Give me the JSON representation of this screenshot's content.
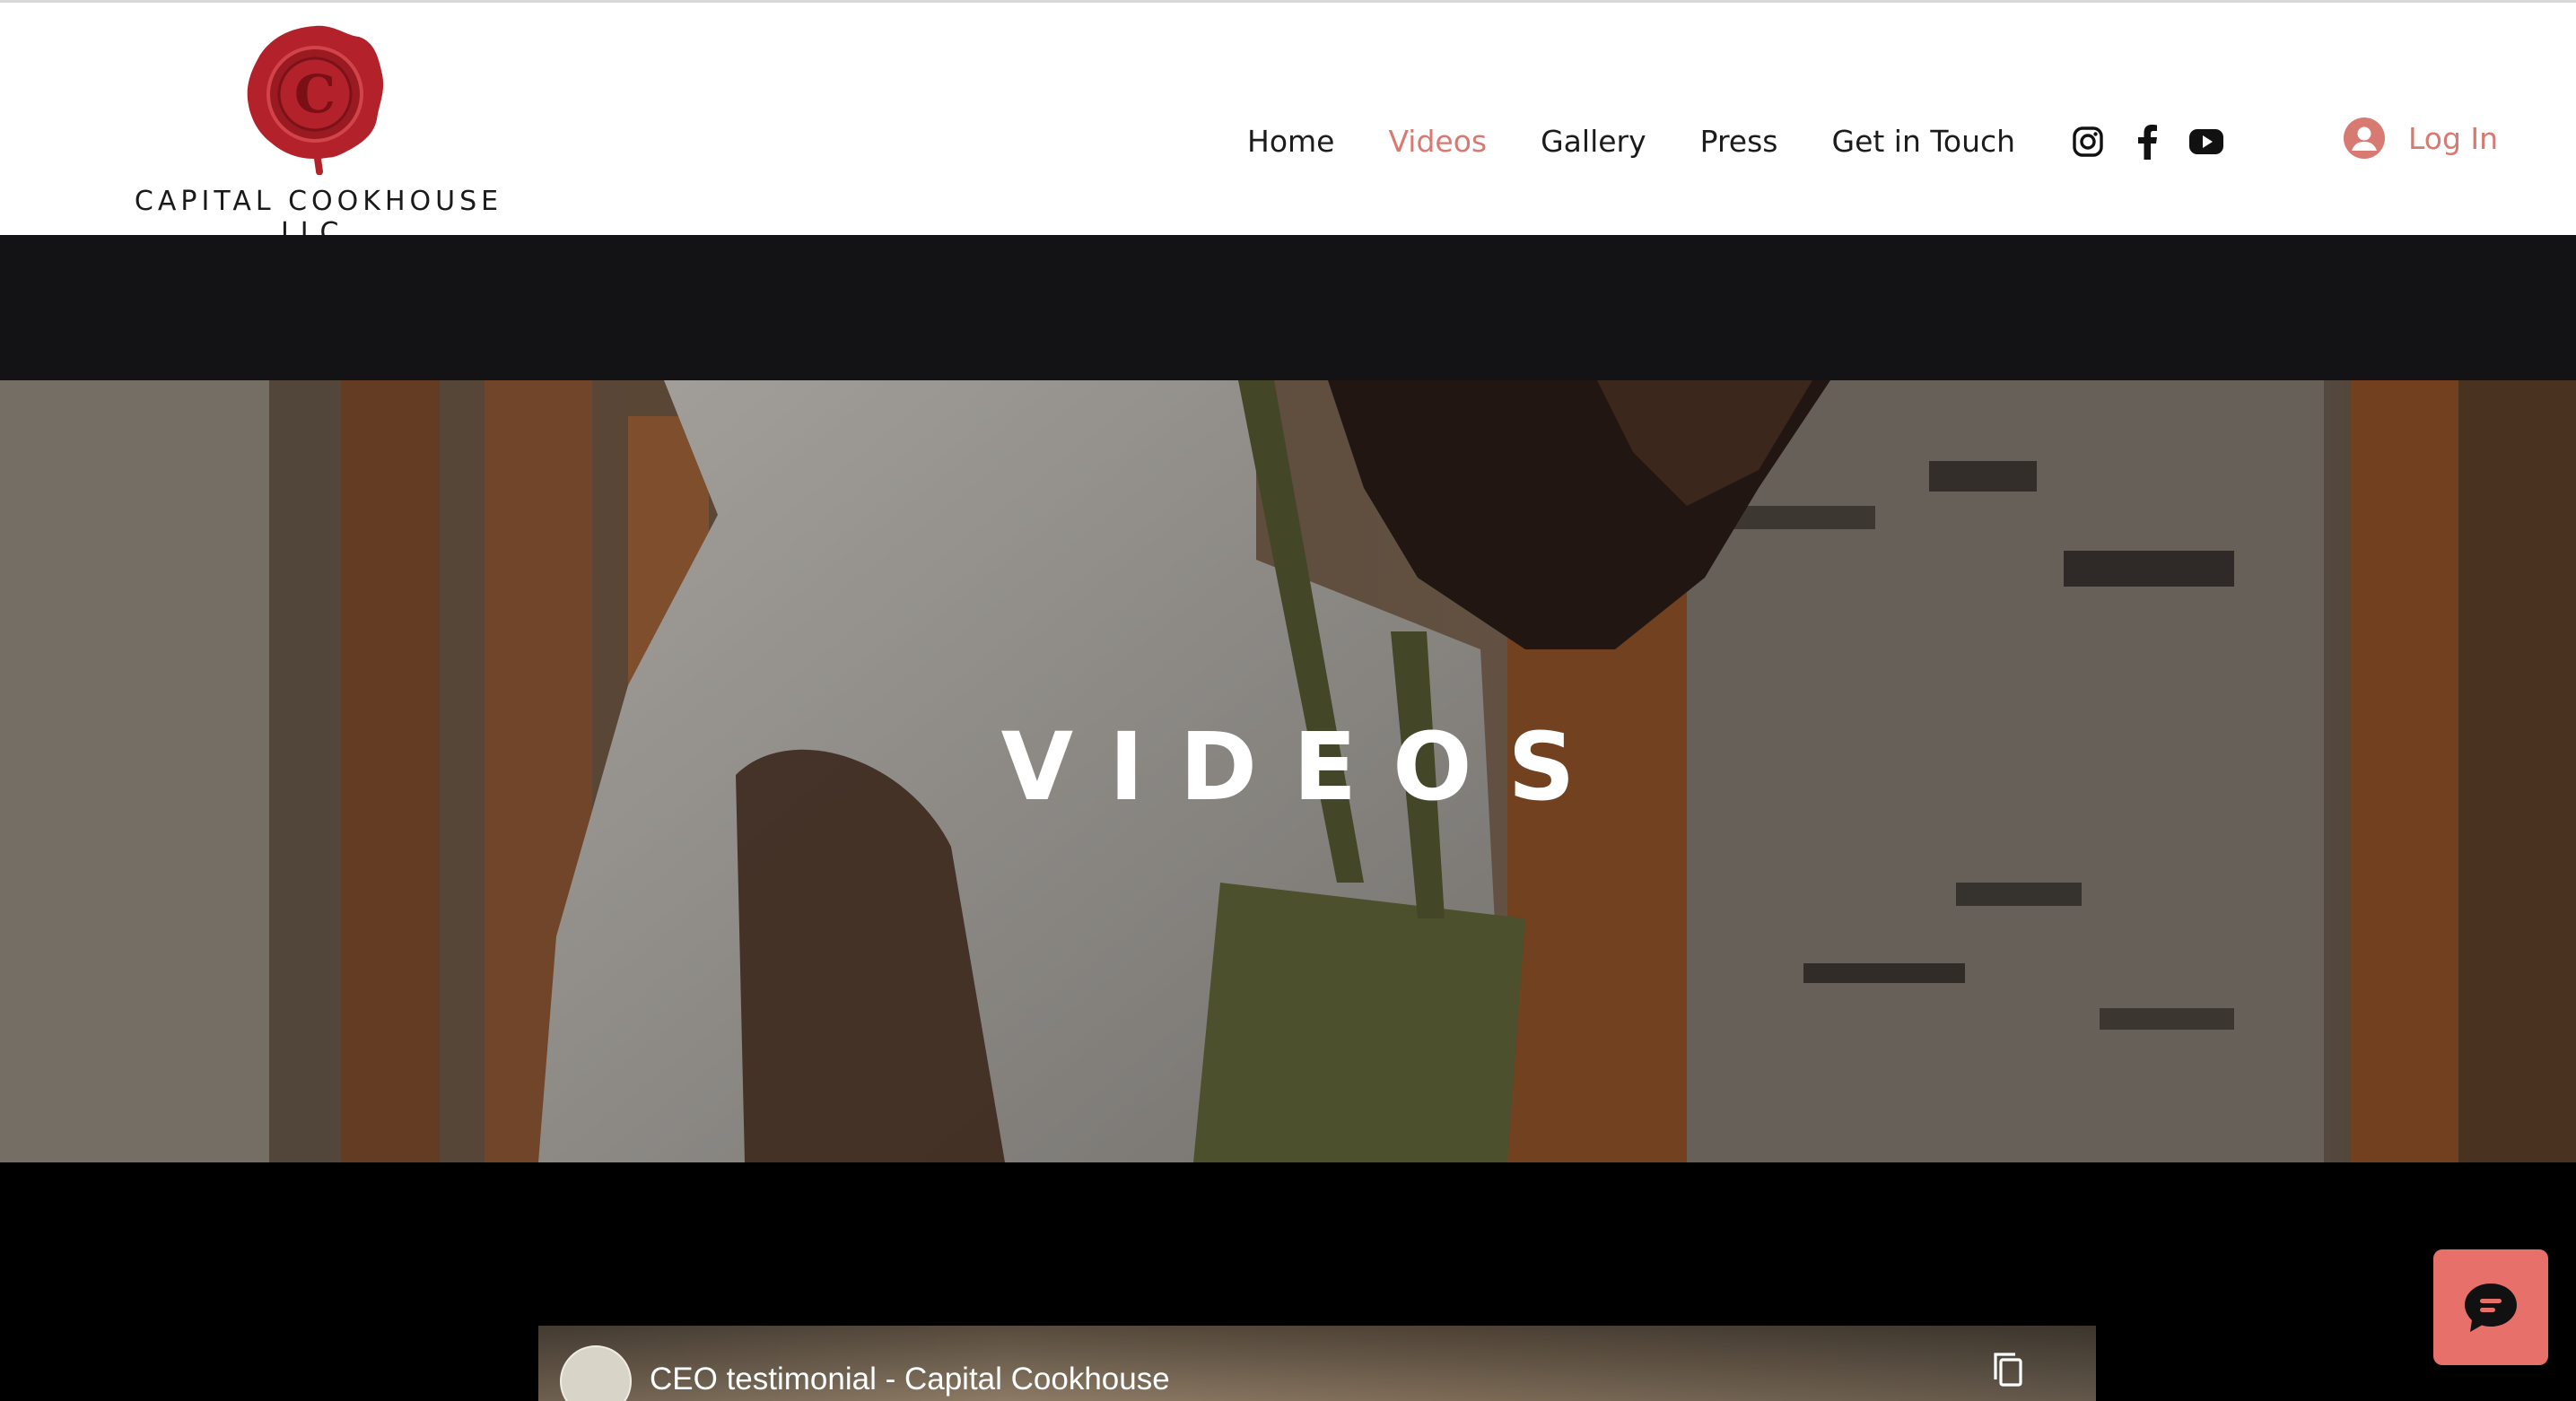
{
  "brand": {
    "name": "CAPITAL COOKHOUSE LLC.",
    "seal_letter": "C",
    "seal_color": "#b3222a"
  },
  "nav": {
    "items": [
      {
        "label": "Home",
        "active": false
      },
      {
        "label": "Videos",
        "active": true
      },
      {
        "label": "Gallery",
        "active": false
      },
      {
        "label": "Press",
        "active": false
      },
      {
        "label": "Get in Touch",
        "active": false
      }
    ],
    "active_color": "#d67a72"
  },
  "social": [
    "instagram-icon",
    "facebook-icon",
    "youtube-icon"
  ],
  "login": {
    "label": "Log In"
  },
  "hero": {
    "title": "VIDEOS"
  },
  "video": {
    "title": "CEO testimonial - Capital Cookhouse"
  },
  "chat": {
    "icon": "chat-bubble-icon",
    "color": "#e8706a"
  }
}
